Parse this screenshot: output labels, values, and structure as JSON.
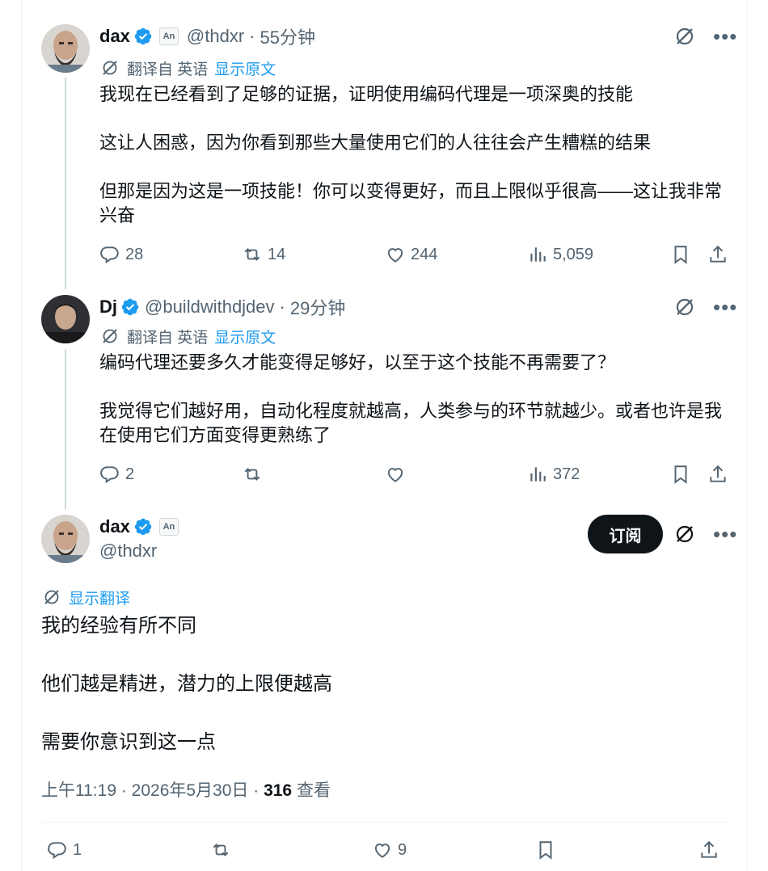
{
  "tweets": [
    {
      "name": "dax",
      "handle": "@thdxr",
      "time": "55分钟",
      "label_badge": "An",
      "translate_prefix": "翻译自 英语",
      "translate_link": "显示原文",
      "paragraphs": [
        "我现在已经看到了足够的证据，证明使用编码代理是一项深奥的技能",
        "这让人困惑，因为你看到那些大量使用它们的人往往会产生糟糕的结果",
        "但那是因为这是一项技能！你可以变得更好，而且上限似乎很高——这让我非常兴奋"
      ],
      "stats": {
        "replies": "28",
        "retweets": "14",
        "likes": "244",
        "views": "5,059"
      }
    },
    {
      "name": "Dj",
      "handle": "@buildwithdjdev",
      "time": "29分钟",
      "translate_prefix": "翻译自 英语",
      "translate_link": "显示原文",
      "paragraphs": [
        "编码代理还要多久才能变得足够好，以至于这个技能不再需要了？",
        "我觉得它们越好用，自动化程度就越高，人类参与的环节就越少。或者也许是我在使用它们方面变得更熟练了"
      ],
      "stats": {
        "replies": "2",
        "retweets": "",
        "likes": "",
        "views": "372"
      }
    }
  ],
  "main": {
    "name": "dax",
    "handle": "@thdxr",
    "label_badge": "An",
    "subscribe_label": "订阅",
    "show_translation": "显示翻译",
    "paragraphs": [
      "我的经验有所不同",
      "他们越是精进，潜力的上限便越高",
      "需要你意识到这一点"
    ],
    "time_date": "上午11:19 · 2026年5月30日 · ",
    "views_count": "316",
    "views_label": " 查看",
    "stats": {
      "replies": "1",
      "retweets": "",
      "likes": "9"
    }
  },
  "colors": {
    "accent": "#1d9bf0",
    "muted": "#536471",
    "text": "#0f1419",
    "thread_line": "#cfd9de"
  }
}
